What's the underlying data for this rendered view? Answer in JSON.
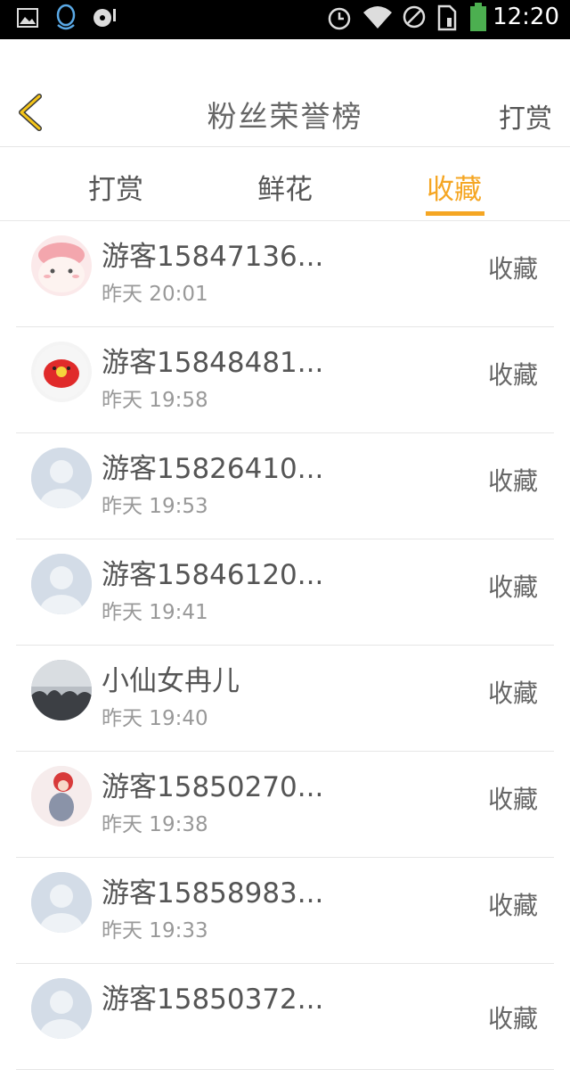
{
  "status_bar": {
    "time": "12:20",
    "icons": [
      "image-icon",
      "qq-icon",
      "music-icon",
      "alarm-icon",
      "wifi-icon",
      "no-sim-icon",
      "sd-card-icon",
      "battery-icon"
    ]
  },
  "header": {
    "title": "粉丝荣誉榜",
    "right_action": "打赏"
  },
  "tabs": [
    {
      "label": "打赏",
      "active": false
    },
    {
      "label": "鲜花",
      "active": false
    },
    {
      "label": "收藏",
      "active": true
    }
  ],
  "accent_color": "#f5a623",
  "fans": [
    {
      "name": "游客15847136...",
      "time": "昨天 20:01",
      "action": "收藏",
      "avatar": "pink-bunny"
    },
    {
      "name": "游客15848481...",
      "time": "昨天 19:58",
      "action": "收藏",
      "avatar": "red-chick"
    },
    {
      "name": "游客15826410...",
      "time": "昨天 19:53",
      "action": "收藏",
      "avatar": "default"
    },
    {
      "name": "游客15846120...",
      "time": "昨天 19:41",
      "action": "收藏",
      "avatar": "default"
    },
    {
      "name": "小仙女冉儿",
      "time": "昨天 19:40",
      "action": "收藏",
      "avatar": "photo-sky"
    },
    {
      "name": "游客15850270...",
      "time": "昨天 19:38",
      "action": "收藏",
      "avatar": "anime-girl"
    },
    {
      "name": "游客15858983...",
      "time": "昨天 19:33",
      "action": "收藏",
      "avatar": "default"
    },
    {
      "name": "游客15850372...",
      "time": "",
      "action": "收藏",
      "avatar": "default"
    }
  ]
}
